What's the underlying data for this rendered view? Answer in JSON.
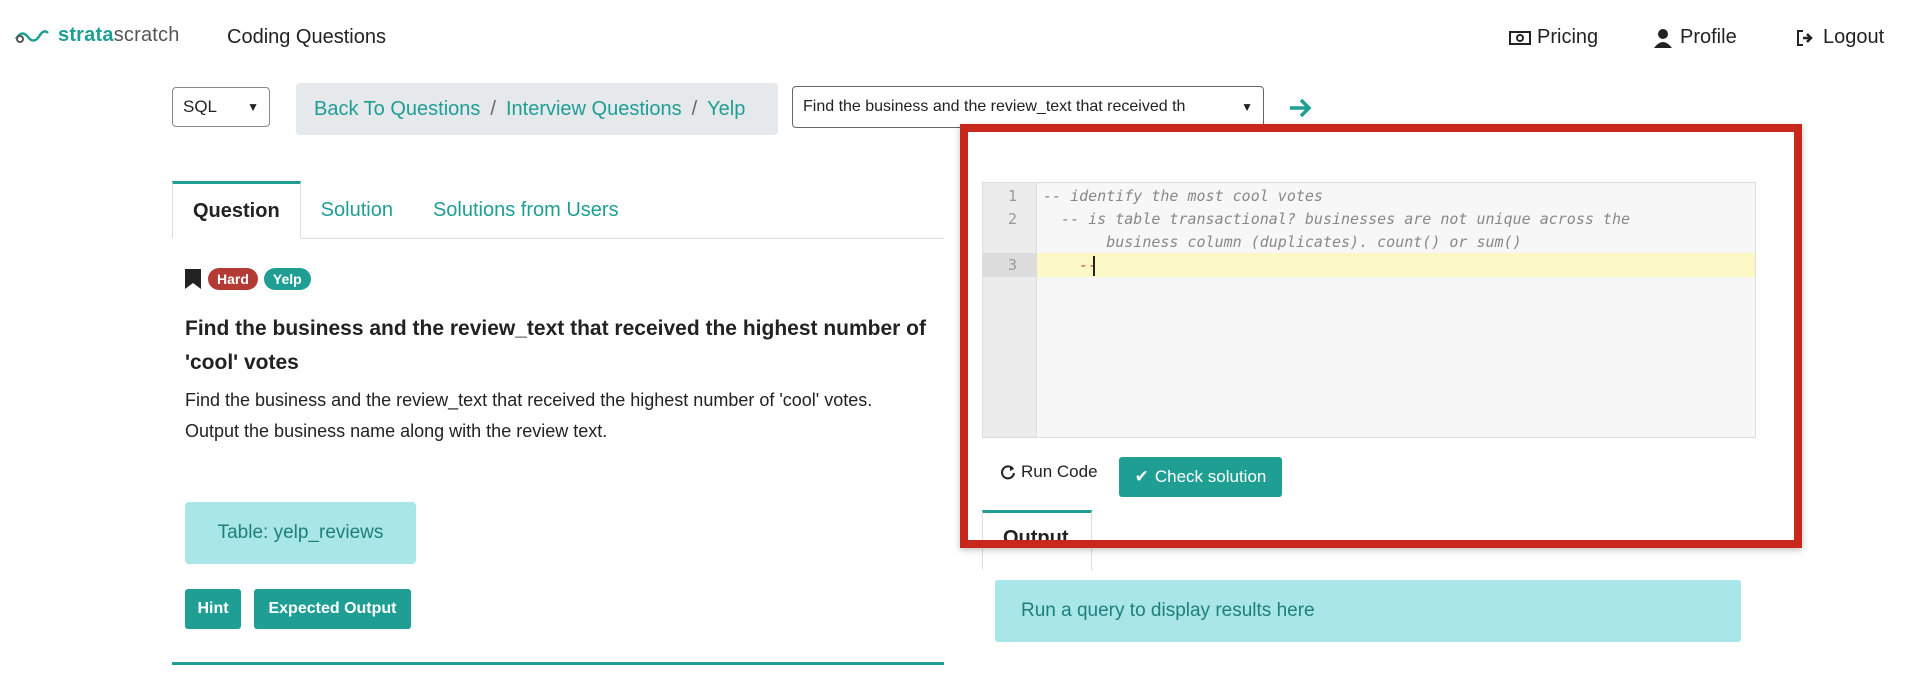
{
  "header": {
    "logo_bold": "strata",
    "logo_rest": "scratch",
    "nav_title": "Coding Questions",
    "links": {
      "pricing": "Pricing",
      "profile": "Profile",
      "logout": "Logout"
    }
  },
  "toolbar": {
    "language": "SQL",
    "breadcrumbs": [
      "Back To Questions",
      "Interview Questions",
      "Yelp"
    ],
    "breadcrumb_sep": "/",
    "question_select": "Find the business and the review_text that received th"
  },
  "tabs": [
    "Question",
    "Solution",
    "Solutions from Users"
  ],
  "question": {
    "difficulty": "Hard",
    "company": "Yelp",
    "title": "Find the business and the review_text that received the highest number of 'cool' votes",
    "body_line1": "Find the business and the review_text that received the highest number of  'cool' votes.",
    "body_line2": "Output the business name along with the review text.",
    "table_label": "Table: yelp_reviews",
    "hint_label": "Hint",
    "expected_output_label": "Expected Output"
  },
  "editor": {
    "lines": [
      {
        "num": "1",
        "text": "-- identify the most cool votes"
      },
      {
        "num": "2",
        "text": "  -- is table transactional? businesses are not unique across the"
      },
      {
        "num": "",
        "text": "       business column (duplicates). count() or sum()"
      },
      {
        "num": "3",
        "text": "    --"
      }
    ]
  },
  "actions": {
    "run_code": "Run Code",
    "check_solution": "Check solution"
  },
  "output": {
    "tab_label": "Output",
    "placeholder": "Run a query to display results here"
  },
  "colors": {
    "accent": "#1f9e94",
    "hard_badge": "#b33b33",
    "highlight": "#c8281c",
    "info_box": "#a8e6e8"
  }
}
